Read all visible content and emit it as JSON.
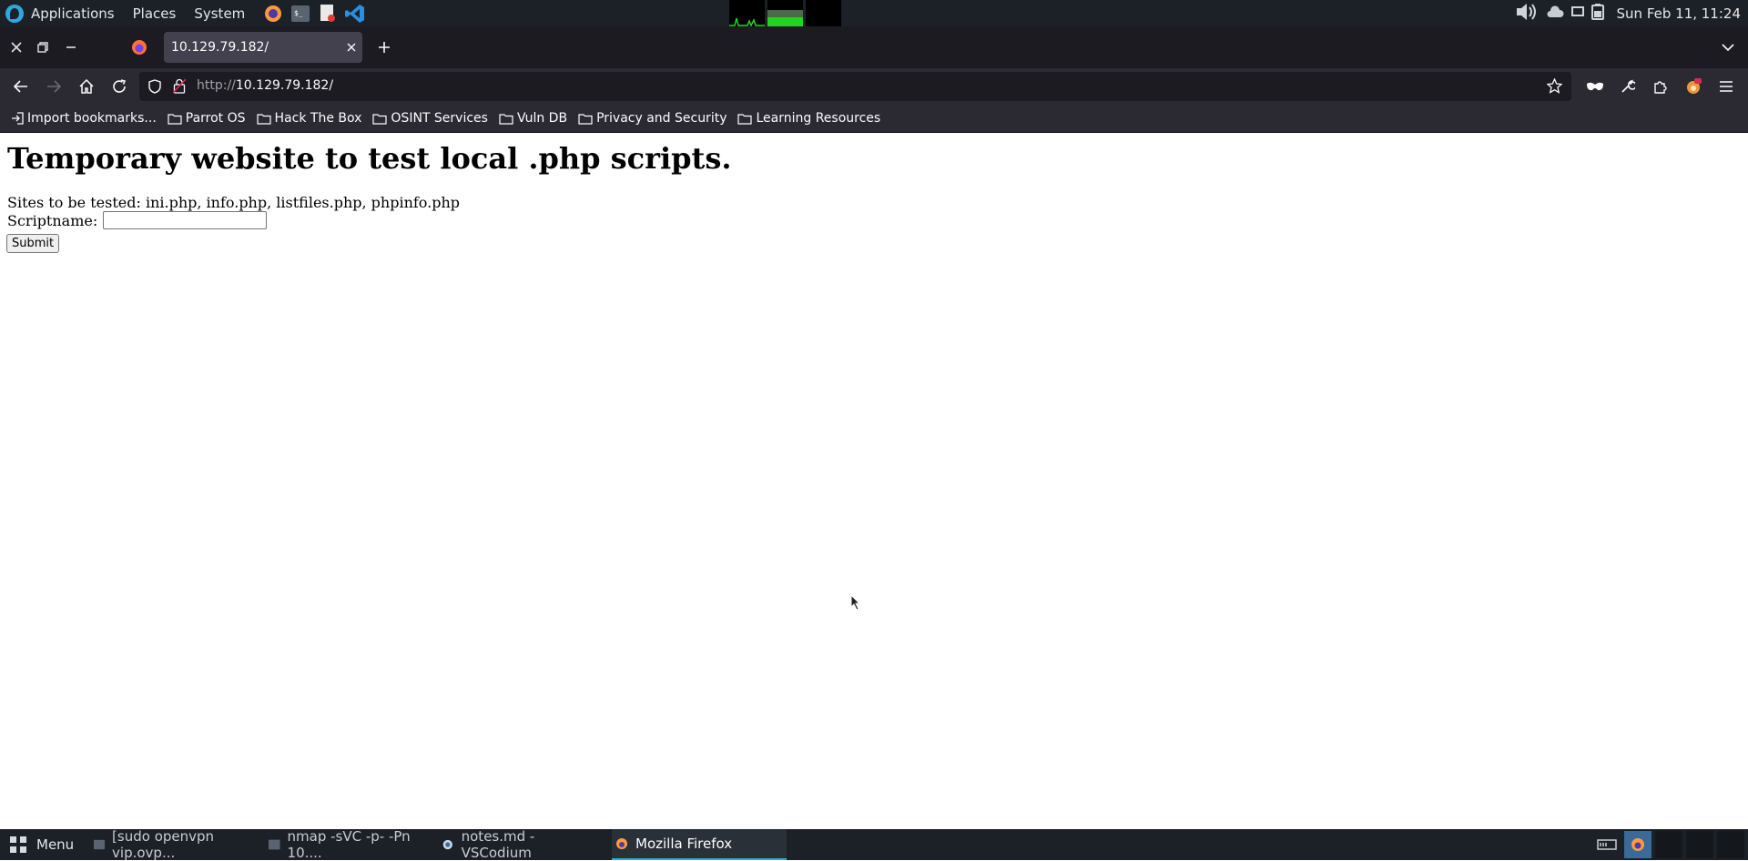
{
  "system_panel": {
    "menus": [
      "Applications",
      "Places",
      "System"
    ],
    "clock": "Sun Feb 11, 11:24"
  },
  "browser": {
    "tab_title": "10.129.79.182/",
    "url_protocol": "http://",
    "url_host": "10.129.79.182/",
    "bookmarks": [
      "Import bookmarks...",
      "Parrot OS",
      "Hack The Box",
      "OSINT Services",
      "Vuln DB",
      "Privacy and Security",
      "Learning Resources"
    ]
  },
  "page": {
    "heading": "Temporary website to test local .php scripts.",
    "sites_line": "Sites to be tested: ini.php, info.php, listfiles.php, phpinfo.php",
    "scriptname_label": "Scriptname:",
    "scriptname_value": "",
    "submit_label": "Submit"
  },
  "taskbar": {
    "menu_label": "Menu",
    "items": [
      "[sudo openvpn vip.ovp...",
      "nmap -sVC -p- -Pn 10....",
      "notes.md - VSCodium",
      "Mozilla Firefox"
    ],
    "active_index": 3
  },
  "colors": {
    "panel_bg": "#1c2128",
    "firefox_toolbar": "#2b2a33",
    "firefox_tabstrip": "#1c1b22",
    "accent": "#2fa8e0"
  }
}
